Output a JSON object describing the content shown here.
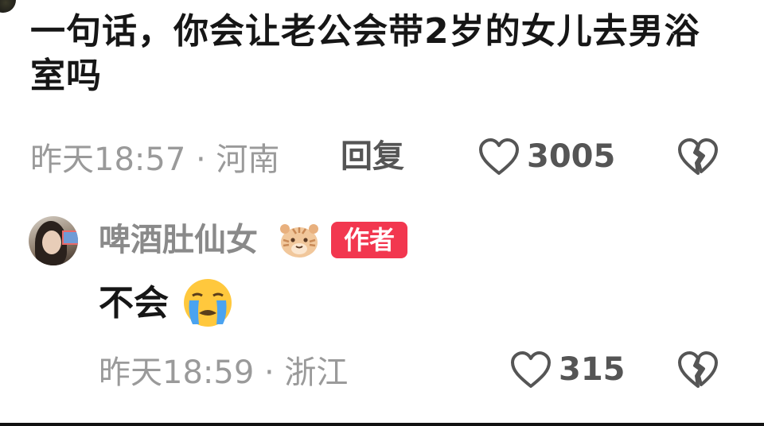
{
  "comment": {
    "text": "一句话，你会让老公会带2岁的女儿去男浴室吗",
    "time_location": "昨天18:57 · 河南",
    "reply_label": "回复",
    "like_count": "3005",
    "icons": {
      "like": "heart-outline-icon",
      "dislike": "broken-heart-icon"
    }
  },
  "reply": {
    "username": "啤酒肚仙女",
    "badge_label": "作者",
    "badge_color": "#f2374f",
    "text": "不会",
    "time_location": "昨天18:59 · 浙江",
    "like_count": "315",
    "icons": {
      "avatar": "user-avatar",
      "username_emoji": "tiger-face-icon",
      "text_emoji": "loudly-crying-face-icon",
      "like": "heart-outline-icon",
      "dislike": "broken-heart-icon"
    }
  }
}
